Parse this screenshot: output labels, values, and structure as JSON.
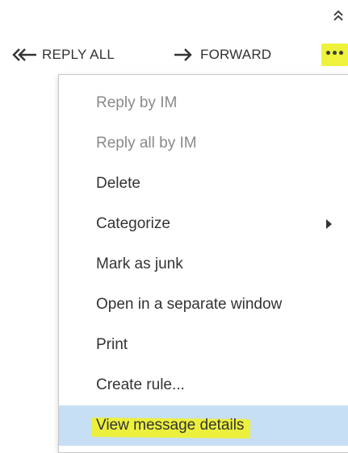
{
  "toolbar": {
    "reply_all_label": "REPLY ALL",
    "forward_label": "FORWARD"
  },
  "menu": {
    "items": [
      {
        "label": "Reply by IM"
      },
      {
        "label": "Reply all by IM"
      },
      {
        "label": "Delete"
      },
      {
        "label": "Categorize"
      },
      {
        "label": "Mark as junk"
      },
      {
        "label": "Open in a separate window"
      },
      {
        "label": "Print"
      },
      {
        "label": "Create rule..."
      },
      {
        "label": "View message details"
      }
    ]
  },
  "colors": {
    "highlight": "#ecf03c",
    "selected_bg": "#c7dff5",
    "text": "#333333",
    "disabled_text": "#8a8a8a"
  },
  "icons": {
    "collapse": "double-chevron-up-icon",
    "reply_all": "double-arrow-left-icon",
    "forward": "arrow-right-icon",
    "more": "more-ellipsis-icon",
    "submenu": "caret-right-icon"
  }
}
